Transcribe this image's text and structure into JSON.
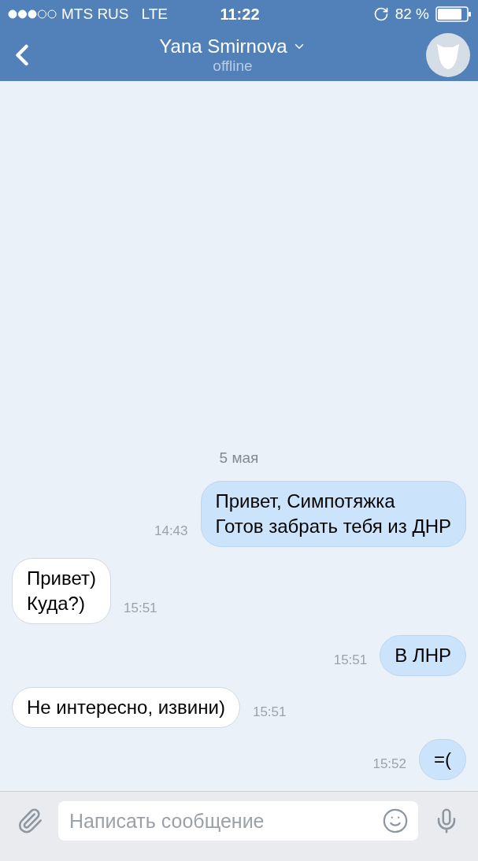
{
  "status_bar": {
    "carrier": "MTS RUS",
    "network": "LTE",
    "time": "11:22",
    "battery": "82 %"
  },
  "header": {
    "title": "Yana Smirnova",
    "status": "offline"
  },
  "date_separator": "5 мая",
  "messages": [
    {
      "kind": "outgoing",
      "lines": [
        "Привет, Симпотяжка",
        "Готов забрать тебя из ДНР"
      ],
      "time": "14:43"
    },
    {
      "kind": "incoming",
      "lines": [
        "Привет)",
        "Куда?)"
      ],
      "time": "15:51"
    },
    {
      "kind": "outgoing",
      "lines": [
        "В ЛНР"
      ],
      "time": "15:51"
    },
    {
      "kind": "incoming",
      "lines": [
        "Не интересно, извини)"
      ],
      "time": "15:51"
    },
    {
      "kind": "outgoing",
      "lines": [
        "=("
      ],
      "time": "15:52"
    }
  ],
  "composer": {
    "placeholder": "Написать сообщение"
  }
}
